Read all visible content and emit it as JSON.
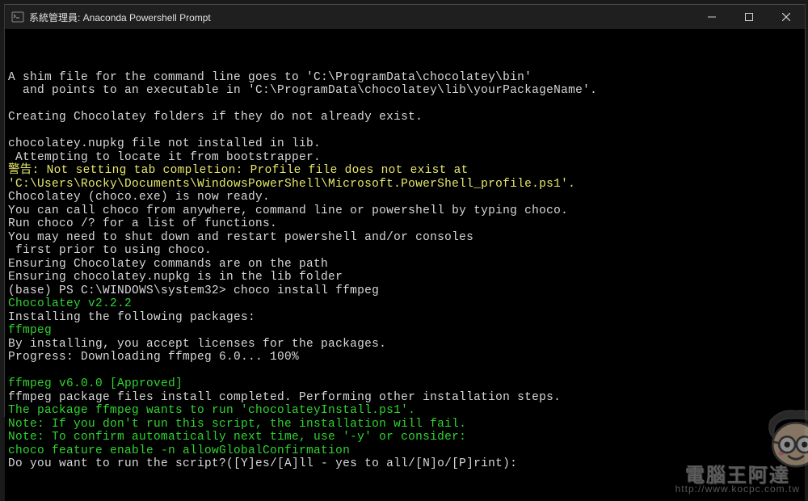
{
  "window": {
    "title": "系統管理員: Anaconda Powershell Prompt"
  },
  "terminal": {
    "lines": [
      {
        "segments": [
          {
            "cls": "c-w",
            "text": "A shim file for the command line goes to 'C:\\ProgramData\\chocolatey\\bin'"
          }
        ]
      },
      {
        "segments": [
          {
            "cls": "c-w",
            "text": "  and points to an executable in 'C:\\ProgramData\\chocolatey\\lib\\yourPackageName'."
          }
        ]
      },
      {
        "segments": [
          {
            "cls": "c-w",
            "text": ""
          }
        ]
      },
      {
        "segments": [
          {
            "cls": "c-w",
            "text": "Creating Chocolatey folders if they do not already exist."
          }
        ]
      },
      {
        "segments": [
          {
            "cls": "c-w",
            "text": ""
          }
        ]
      },
      {
        "segments": [
          {
            "cls": "c-w",
            "text": "chocolatey.nupkg file not installed in lib."
          }
        ]
      },
      {
        "segments": [
          {
            "cls": "c-w",
            "text": " Attempting to locate it from bootstrapper."
          }
        ]
      },
      {
        "segments": [
          {
            "cls": "c-y",
            "text": "警告: Not setting tab completion: Profile file does not exist at"
          }
        ]
      },
      {
        "segments": [
          {
            "cls": "c-y",
            "text": "'C:\\Users\\Rocky\\Documents\\WindowsPowerShell\\Microsoft.PowerShell_profile.ps1'."
          }
        ]
      },
      {
        "segments": [
          {
            "cls": "c-w",
            "text": "Chocolatey (choco.exe) is now ready."
          }
        ]
      },
      {
        "segments": [
          {
            "cls": "c-w",
            "text": "You can call choco from anywhere, command line or powershell by typing choco."
          }
        ]
      },
      {
        "segments": [
          {
            "cls": "c-w",
            "text": "Run choco /? for a list of functions."
          }
        ]
      },
      {
        "segments": [
          {
            "cls": "c-w",
            "text": "You may need to shut down and restart powershell and/or consoles"
          }
        ]
      },
      {
        "segments": [
          {
            "cls": "c-w",
            "text": " first prior to using choco."
          }
        ]
      },
      {
        "segments": [
          {
            "cls": "c-w",
            "text": "Ensuring Chocolatey commands are on the path"
          }
        ]
      },
      {
        "segments": [
          {
            "cls": "c-w",
            "text": "Ensuring chocolatey.nupkg is in the lib folder"
          }
        ]
      },
      {
        "segments": [
          {
            "cls": "c-w",
            "text": "(base) PS C:\\WINDOWS\\system32> "
          },
          {
            "cls": "c-w",
            "text": "choco install ffmpeg"
          }
        ]
      },
      {
        "segments": [
          {
            "cls": "c-g",
            "text": "Chocolatey v2.2.2"
          }
        ]
      },
      {
        "segments": [
          {
            "cls": "c-w",
            "text": "Installing the following packages:"
          }
        ]
      },
      {
        "segments": [
          {
            "cls": "c-g",
            "text": "ffmpeg"
          }
        ]
      },
      {
        "segments": [
          {
            "cls": "c-w",
            "text": "By installing, you accept licenses for the packages."
          }
        ]
      },
      {
        "segments": [
          {
            "cls": "c-w",
            "text": "Progress: Downloading ffmpeg 6.0... 100%"
          }
        ]
      },
      {
        "segments": [
          {
            "cls": "c-w",
            "text": ""
          }
        ]
      },
      {
        "segments": [
          {
            "cls": "c-g",
            "text": "ffmpeg v6.0.0 [Approved]"
          }
        ]
      },
      {
        "segments": [
          {
            "cls": "c-w",
            "text": "ffmpeg package files install completed. Performing other installation steps."
          }
        ]
      },
      {
        "segments": [
          {
            "cls": "c-g",
            "text": "The package ffmpeg wants to run 'chocolateyInstall.ps1'."
          }
        ]
      },
      {
        "segments": [
          {
            "cls": "c-g",
            "text": "Note: If you don't run this script, the installation will fail."
          }
        ]
      },
      {
        "segments": [
          {
            "cls": "c-g",
            "text": "Note: To confirm automatically next time, use '-y' or consider:"
          }
        ]
      },
      {
        "segments": [
          {
            "cls": "c-g",
            "text": "choco feature enable -n allowGlobalConfirmation"
          }
        ]
      },
      {
        "segments": [
          {
            "cls": "c-w",
            "text": "Do you want to run the script?([Y]es/[A]ll - yes to all/[N]o/[P]rint):"
          }
        ]
      }
    ]
  },
  "watermark": {
    "text": "電腦王阿達",
    "url": "http://www.kocpc.com.tw"
  }
}
